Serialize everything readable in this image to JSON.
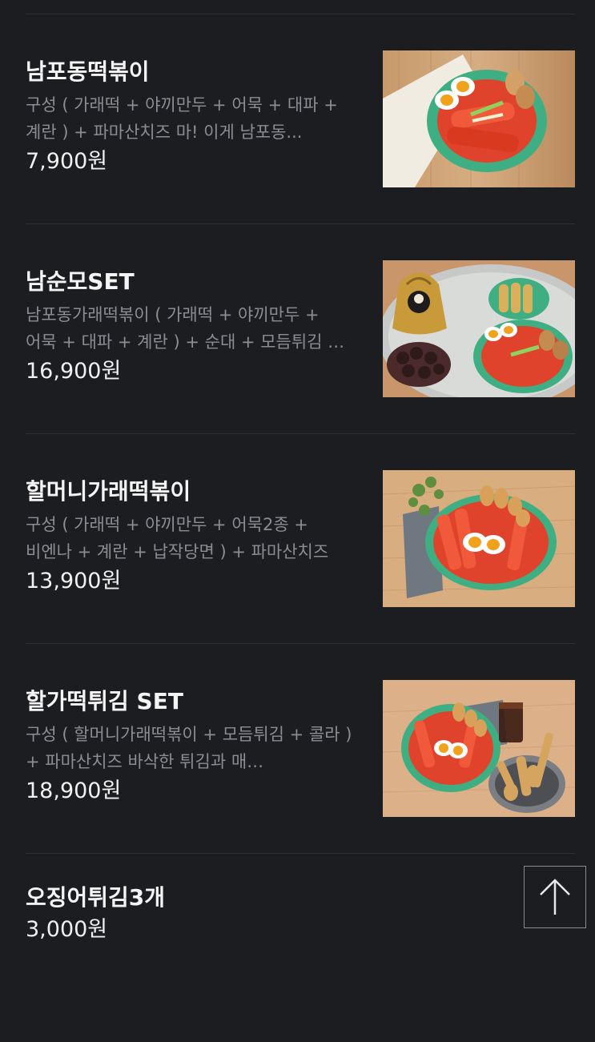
{
  "menu": {
    "items": [
      {
        "name": "남포동떡볶이",
        "description": "구성 ( 가래떡 + 야끼만두 + 어묵 + 대파 + 계란 ) + 파마산치즈 마! 이게 남포동...",
        "price": "7,900원",
        "image_icon": "tteokbokki-photo"
      },
      {
        "name": "남순모SET",
        "description": "남포동가래떡볶이 ( 가래떡 + 야끼만두 + 어묵 + 대파 + 계란 ) + 순대 + 모듬튀김 + …",
        "price": "16,900원",
        "image_icon": "set-meal-photo"
      },
      {
        "name": "할머니가래떡볶이",
        "description": "구성 ( 가래떡 + 야끼만두 + 어묵2종 + 비엔나 + 계란 + 납작당면 ) + 파마산치즈",
        "price": "13,900원",
        "image_icon": "tteokbokki-photo"
      },
      {
        "name": "할가떡튀김 SET",
        "description": "구성 ( 할머니가래떡볶이 + 모듬튀김 + 콜라 ) + 파마산치즈 바삭한 튀김과 매…",
        "price": "18,900원",
        "image_icon": "tteokbokki-fries-photo"
      },
      {
        "name": "오징어튀김3개",
        "description": "",
        "price": "3,000원",
        "image_icon": ""
      }
    ]
  },
  "scroll_top_button": {
    "icon": "arrow-up-icon"
  },
  "colors": {
    "background": "#1c1d21",
    "divider": "#2f3035",
    "description": "#8c8d93",
    "sauce": "#e0432b",
    "bowl": "#3fae82"
  }
}
